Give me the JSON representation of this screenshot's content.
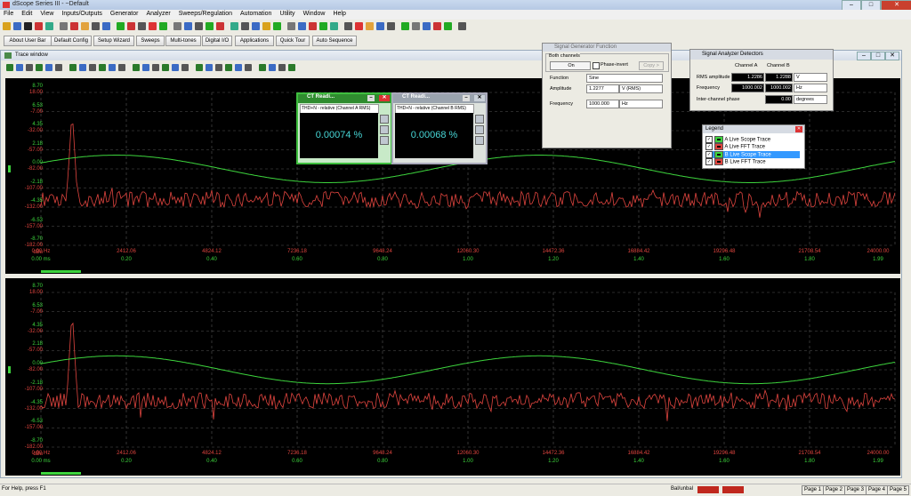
{
  "app": {
    "window_title": "dScope Series III - ~Default"
  },
  "menu": [
    "File",
    "Edit",
    "View",
    "Inputs/Outputs",
    "Generator",
    "Analyzer",
    "Sweeps/Regulation",
    "Automation",
    "Utility",
    "Window",
    "Help"
  ],
  "quick_bar": [
    "About User Bar",
    "Default Config",
    "Setup Wizard",
    "Sweeps",
    "Multi-tones",
    "Digital I/O",
    "Applications",
    "Quick Tour",
    "Auto Sequence"
  ],
  "trace_window": {
    "title": "Trace window"
  },
  "plot": {
    "y_labels_dB": [
      "8.70",
      "6.53",
      "4.35",
      "2.18",
      "0.00",
      "-2.18",
      "-4.35",
      "-6.53",
      "-8.70"
    ],
    "y_labels_dBu": [
      "18.00",
      "-7.00",
      "-32.00",
      "-57.00",
      "-82.00",
      "-107.00",
      "-132.00",
      "-157.00",
      "-182.00"
    ],
    "y_unit_dB": "dBu",
    "x_labels_hz": [
      "0.00 Hz",
      "2412.06",
      "4824.12",
      "7236.18",
      "9648.24",
      "12060.30",
      "14472.36",
      "16884.42",
      "19296.48",
      "21708.54",
      "24000.00"
    ],
    "x_labels_ms": [
      "0.00 ms",
      "0.20",
      "0.40",
      "0.60",
      "0.80",
      "1.00",
      "1.20",
      "1.40",
      "1.60",
      "1.80",
      "1.99"
    ]
  },
  "ct_reading_a": {
    "title": "CT Readi...",
    "subtitle": "THD+N - relative (Channel A RMS)",
    "value": "0.00074 %"
  },
  "ct_reading_b": {
    "title": "CT Readi...",
    "subtitle": "THD+N - relative (Channel B RMS)",
    "value": "0.00068 %"
  },
  "generator": {
    "title": "Signal Generator Function",
    "group": "Both channels",
    "on_label": "On",
    "phase_invert": "Phase-invert",
    "copy_label": "Copy >",
    "function_label": "Function",
    "function_value": "Sine",
    "amplitude_label": "Amplitude",
    "amplitude_value": "1.2277",
    "amplitude_unit": "V (RMS)",
    "frequency_label": "Frequency",
    "frequency_value": "1000.000",
    "frequency_unit": "Hz"
  },
  "analyzer": {
    "title": "Signal Analyzer Detectors",
    "col_a": "Channel A",
    "col_b": "Channel B",
    "rms_label": "RMS amplitude",
    "rms_a": "1.2286",
    "rms_b": "1.2288",
    "rms_unit": "V",
    "freq_label": "Frequency",
    "freq_a": "1000.002",
    "freq_b": "1000.002",
    "freq_unit": "Hz",
    "phase_label": "Inter-channel phase",
    "phase_value": "0.00",
    "phase_unit": "degrees"
  },
  "legend": {
    "title": "Legend",
    "items": [
      {
        "label": "A  Live Scope Trace",
        "color": "#3dd43d",
        "selected": false
      },
      {
        "label": "A  Live FFT Trace",
        "color": "#e0453f",
        "selected": false
      },
      {
        "label": "B  Live Scope Trace",
        "color": "#3dd43d",
        "selected": true
      },
      {
        "label": "B  Live FFT Trace",
        "color": "#e0453f",
        "selected": false
      }
    ]
  },
  "status": {
    "help": "For Help, press F1",
    "bal": "Bal/unbal",
    "pages": [
      "Page 1",
      "Page 2",
      "Page 3",
      "Page 4",
      "Page 5"
    ]
  },
  "colors": {
    "scope_trace": "#3dd43d",
    "fft_trace": "#e0453f",
    "plot_bg": "#000000"
  }
}
